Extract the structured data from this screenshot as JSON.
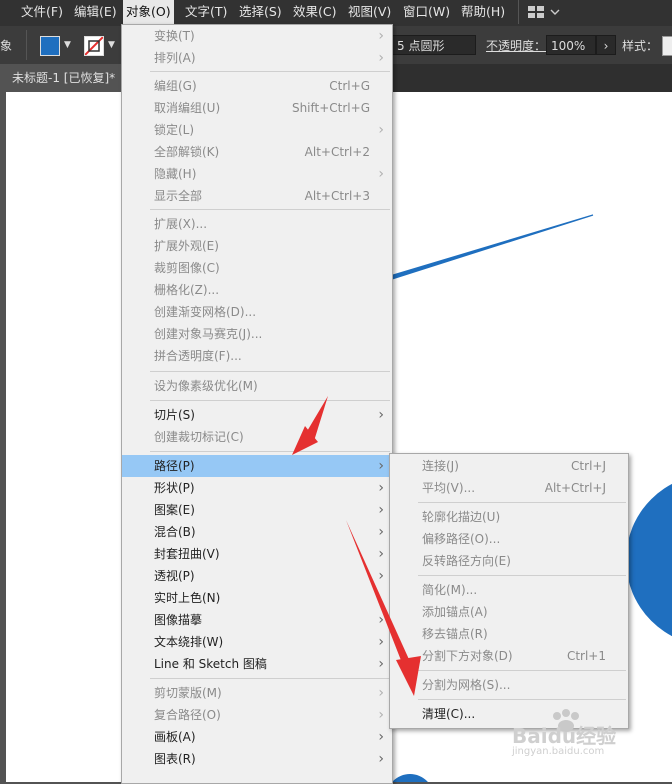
{
  "menubar": {
    "items": [
      {
        "label": "文件(F)"
      },
      {
        "label": "编辑(E)"
      },
      {
        "label": "对象(O)"
      },
      {
        "label": "文字(T)"
      },
      {
        "label": "选择(S)"
      },
      {
        "label": "效果(C)"
      },
      {
        "label": "视图(V)"
      },
      {
        "label": "窗口(W)"
      },
      {
        "label": "帮助(H)"
      }
    ],
    "workspace_icon": "grid-layout-icon"
  },
  "toolbar": {
    "left_cut_label": "象",
    "fill_color": "#1f6fbf",
    "stroke_label": "none",
    "brush_label": "5 点圆形",
    "opacity_label": "不透明度：",
    "opacity_value": "100%",
    "style_label": "样式："
  },
  "document": {
    "tab_title": "未标题-1 [已恢复]*"
  },
  "object_menu": {
    "items": [
      {
        "label": "变换(T)",
        "disabled": true,
        "submenu": true
      },
      {
        "label": "排列(A)",
        "disabled": true,
        "submenu": true
      },
      {
        "label": "编组(G)",
        "disabled": true,
        "shortcut": "Ctrl+G"
      },
      {
        "label": "取消编组(U)",
        "disabled": true,
        "shortcut": "Shift+Ctrl+G"
      },
      {
        "label": "锁定(L)",
        "disabled": true,
        "submenu": true
      },
      {
        "label": "全部解锁(K)",
        "disabled": true,
        "shortcut": "Alt+Ctrl+2"
      },
      {
        "label": "隐藏(H)",
        "disabled": true,
        "submenu": true
      },
      {
        "label": "显示全部",
        "disabled": true,
        "shortcut": "Alt+Ctrl+3"
      },
      {
        "label": "扩展(X)...",
        "disabled": true
      },
      {
        "label": "扩展外观(E)",
        "disabled": true
      },
      {
        "label": "裁剪图像(C)",
        "disabled": true
      },
      {
        "label": "栅格化(Z)...",
        "disabled": true
      },
      {
        "label": "创建渐变网格(D)...",
        "disabled": true
      },
      {
        "label": "创建对象马赛克(J)...",
        "disabled": true
      },
      {
        "label": "拼合透明度(F)...",
        "disabled": true
      },
      {
        "label": "设为像素级优化(M)",
        "disabled": true
      },
      {
        "label": "切片(S)",
        "disabled": false,
        "submenu": true
      },
      {
        "label": "创建裁切标记(C)",
        "disabled": true
      },
      {
        "label": "路径(P)",
        "disabled": false,
        "submenu": true,
        "highlighted": true
      },
      {
        "label": "形状(P)",
        "disabled": false,
        "submenu": true
      },
      {
        "label": "图案(E)",
        "disabled": false,
        "submenu": true
      },
      {
        "label": "混合(B)",
        "disabled": false,
        "submenu": true
      },
      {
        "label": "封套扭曲(V)",
        "disabled": false,
        "submenu": true
      },
      {
        "label": "透视(P)",
        "disabled": false,
        "submenu": true
      },
      {
        "label": "实时上色(N)",
        "disabled": false
      },
      {
        "label": "图像描摹",
        "disabled": false,
        "submenu": true
      },
      {
        "label": "文本绕排(W)",
        "disabled": false,
        "submenu": true
      },
      {
        "label": "Line 和 Sketch 图稿",
        "disabled": false,
        "submenu": true
      },
      {
        "label": "剪切蒙版(M)",
        "disabled": true,
        "submenu": true
      },
      {
        "label": "复合路径(O)",
        "disabled": true,
        "submenu": true
      },
      {
        "label": "画板(A)",
        "disabled": false,
        "submenu": true
      },
      {
        "label": "图表(R)",
        "disabled": false,
        "submenu": true
      }
    ]
  },
  "path_submenu": {
    "items": [
      {
        "label": "连接(J)",
        "disabled": true,
        "shortcut": "Ctrl+J"
      },
      {
        "label": "平均(V)...",
        "disabled": true,
        "shortcut": "Alt+Ctrl+J"
      },
      {
        "label": "轮廓化描边(U)",
        "disabled": true
      },
      {
        "label": "偏移路径(O)...",
        "disabled": true
      },
      {
        "label": "反转路径方向(E)",
        "disabled": true
      },
      {
        "label": "简化(M)...",
        "disabled": true
      },
      {
        "label": "添加锚点(A)",
        "disabled": true
      },
      {
        "label": "移去锚点(R)",
        "disabled": true
      },
      {
        "label": "分割下方对象(D)",
        "disabled": true,
        "shortcut": "Ctrl+1"
      },
      {
        "label": "分割为网格(S)...",
        "disabled": true
      },
      {
        "label": "清理(C)...",
        "disabled": false
      }
    ]
  },
  "watermark": {
    "text": "Baidu经验",
    "sub": "jingyan.baidu.com"
  },
  "colors": {
    "accent_blue": "#1f6fbf",
    "annotation_red": "#e53030",
    "highlight": "#96c8f5"
  }
}
